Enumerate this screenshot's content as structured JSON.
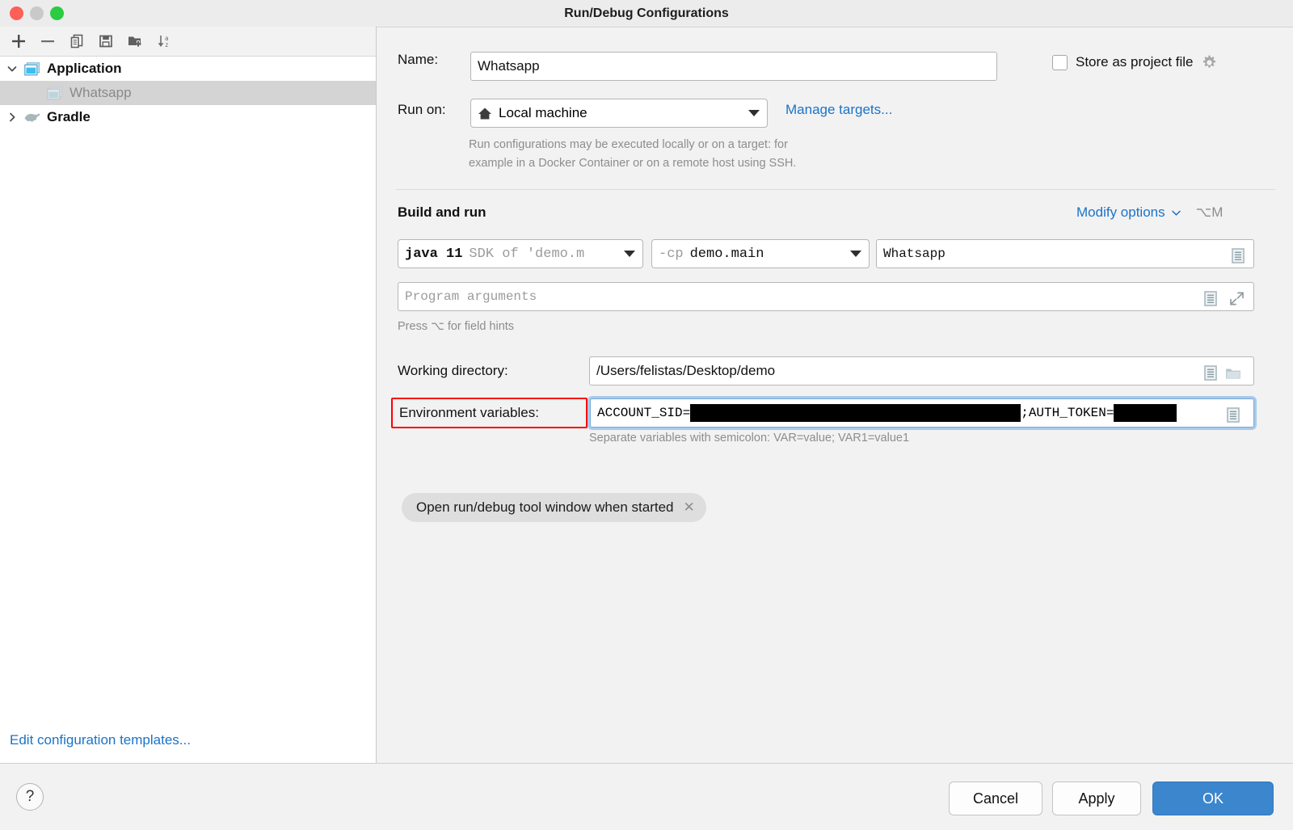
{
  "window": {
    "title": "Run/Debug Configurations",
    "traffic_lights": [
      "close",
      "minimize",
      "zoom"
    ]
  },
  "left_panel": {
    "toolbar": [
      {
        "name": "add-configuration-button",
        "icon": "plus-icon",
        "label": "+"
      },
      {
        "name": "remove-configuration-button",
        "icon": "minus-icon",
        "label": "−"
      },
      {
        "name": "copy-configuration-button",
        "icon": "copy-icon",
        "label": "Copy"
      },
      {
        "name": "save-configuration-button",
        "icon": "save-icon",
        "label": "Save"
      },
      {
        "name": "new-folder-button",
        "icon": "new-folder-icon",
        "label": "New Folder"
      },
      {
        "name": "sort-configurations-button",
        "icon": "sort-az-icon",
        "label": "Sort"
      }
    ],
    "tree": [
      {
        "label": "Application",
        "icon": "application-icon",
        "expanded": true,
        "level": 0,
        "selected": false
      },
      {
        "label": "Whatsapp",
        "icon": "application-config-icon",
        "level": 1,
        "selected": true
      },
      {
        "label": "Gradle",
        "icon": "gradle-elephant-icon",
        "expanded": false,
        "level": 0,
        "selected": false
      }
    ],
    "edit_templates_link": "Edit configuration templates..."
  },
  "form": {
    "name_label": "Name:",
    "name_value": "Whatsapp",
    "store_as_project_file_label": "Store as project file",
    "store_as_project_file_checked": false,
    "run_on_label": "Run on:",
    "run_on_value": "Local machine",
    "manage_targets_link": "Manage targets...",
    "run_on_description_line1": "Run configurations may be executed locally or on a target: for",
    "run_on_description_line2": "example in a Docker Container or on a remote host using SSH.",
    "build_and_run_title": "Build and run",
    "modify_options_link": "Modify options",
    "modify_options_shortcut": "⌥M",
    "jre_value_bold": "java 11",
    "jre_value_dim": "SDK of 'demo.m",
    "classpath_value_dim": "-cp",
    "classpath_value_bold": "demo.main",
    "main_class_value": "Whatsapp",
    "program_arguments_placeholder": "Program arguments",
    "field_hints_text": "Press ⌥ for field hints",
    "working_directory_label": "Working directory:",
    "working_directory_value": "/Users/felistas/Desktop/demo",
    "env_variables_label": "Environment variables:",
    "env_var_1_name": "ACCOUNT_SID=",
    "env_var_1_value_redacted": true,
    "env_separator": ";",
    "env_var_2_name": "AUTH_TOKEN=",
    "env_var_2_value_redacted": true,
    "env_hint": "Separate variables with semicolon: VAR=value; VAR1=value1",
    "option_chip_label": "Open run/debug tool window when started"
  },
  "footer": {
    "help_label": "?",
    "cancel_label": "Cancel",
    "apply_label": "Apply",
    "ok_label": "OK"
  },
  "colors": {
    "link": "#1a73c8",
    "primary_button": "#3b86cd",
    "highlight_box": "#ff0000",
    "focus_ring": "#7aa8d8",
    "selection": "#d4d4d4"
  }
}
